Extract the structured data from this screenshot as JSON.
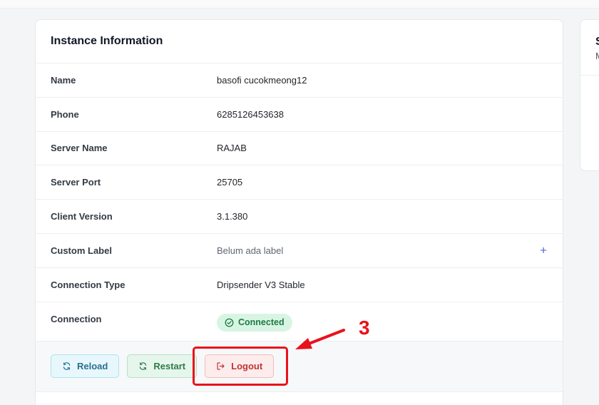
{
  "instance_card": {
    "title": "Instance Information",
    "rows": [
      {
        "label": "Name",
        "value": "basofi cucokmeong12"
      },
      {
        "label": "Phone",
        "value": "6285126453638"
      },
      {
        "label": "Server Name",
        "value": "RAJAB"
      },
      {
        "label": "Server Port",
        "value": "25705"
      },
      {
        "label": "Client Version",
        "value": "3.1.380"
      },
      {
        "label": "Custom Label",
        "value": "Belum ada label",
        "action_icon": "plus-icon"
      },
      {
        "label": "Connection Type",
        "value": "Dripsender V3 Stable"
      },
      {
        "label": "Connection",
        "status": "Connected",
        "status_icon": "check-circle-icon",
        "status_color": "#1f7a44"
      }
    ],
    "actions": {
      "reload": {
        "label": "Reload",
        "icon": "refresh-icon"
      },
      "restart": {
        "label": "Restart",
        "icon": "refresh-icon"
      },
      "logout": {
        "label": "Logout",
        "icon": "logout-icon"
      }
    }
  },
  "annotation": {
    "step": "3",
    "color": "#e8121b"
  },
  "side_card": {
    "title": "S",
    "subtitle": "M"
  }
}
